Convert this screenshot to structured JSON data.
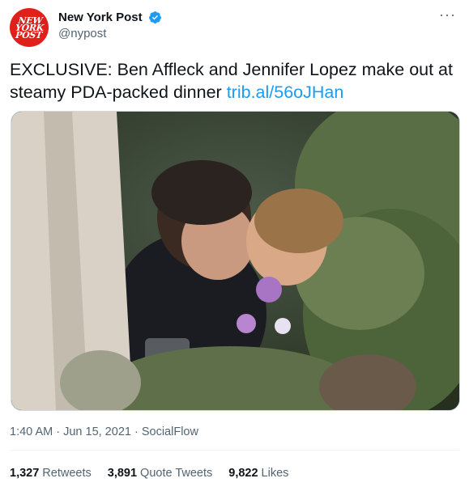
{
  "header": {
    "avatar_text": "NEW YORK POST",
    "name": "New York Post",
    "handle": "@nypost",
    "more_label": "···"
  },
  "tweet": {
    "text": "EXCLUSIVE: Ben Affleck and Jennifer Lopez make out at steamy PDA-packed dinner",
    "link": "trib.al/56oJHan"
  },
  "meta": {
    "time": "1:40 AM",
    "date": "Jun 15, 2021",
    "source": "SocialFlow"
  },
  "stats": {
    "retweets_count": "1,327",
    "retweets_label": "Retweets",
    "quotes_count": "3,891",
    "quotes_label": "Quote Tweets",
    "likes_count": "9,822",
    "likes_label": "Likes"
  },
  "colors": {
    "brand_red": "#e0211b",
    "link_blue": "#1d9bf0",
    "muted": "#536471"
  }
}
